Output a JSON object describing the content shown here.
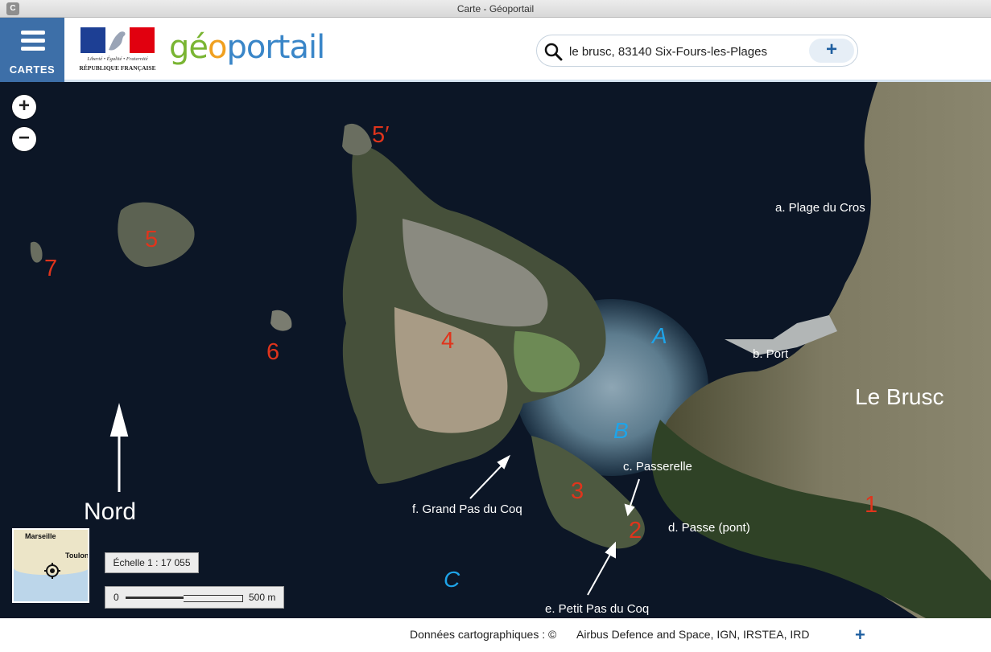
{
  "window": {
    "title": "Carte - Géoportail",
    "app_badge": "C"
  },
  "header": {
    "menu_label": "CARTES",
    "republic_motto": "Liberté • Égalité • Fraternité",
    "republic_name": "RÉPUBLIQUE FRANÇAISE",
    "brand": {
      "part1": "gé",
      "part2": "o",
      "part3": "portail"
    },
    "search": {
      "value": "le brusc, 83140 Six-Fours-les-Plages",
      "add_label": "+"
    }
  },
  "map": {
    "zoom_in": "+",
    "zoom_out": "−",
    "numbers": {
      "n1": "1",
      "n2": "2",
      "n3": "3",
      "n4": "4",
      "n5": "5",
      "n5b": "5′",
      "n6": "6",
      "n7": "7"
    },
    "zones": {
      "a": "A",
      "b": "B",
      "c": "C"
    },
    "places": {
      "plage": "a. Plage du Cros",
      "port": "b. Port",
      "passerelle": "c. Passerelle",
      "passe": "d. Passe (pont)",
      "petit": "e. Petit Pas du Coq",
      "grand": "f. Grand Pas du Coq"
    },
    "town": "Le Brusc",
    "north": "Nord",
    "minimap": {
      "city1": "Marseille",
      "city2": "Toulon"
    },
    "scale": "Échelle 1 : 17 055",
    "scalebar": {
      "start": "0",
      "end": "500 m"
    }
  },
  "footer": {
    "credits": "Données cartographiques : ©",
    "sources": "Airbus Defence and Space,  IGN,  IRSTEA,  IRD",
    "expand": "+"
  },
  "colors": {
    "number_labels": "#e0341c",
    "zone_labels": "#1ea4e9",
    "header_button": "#3d6fa8",
    "sea": "#0c1626"
  }
}
